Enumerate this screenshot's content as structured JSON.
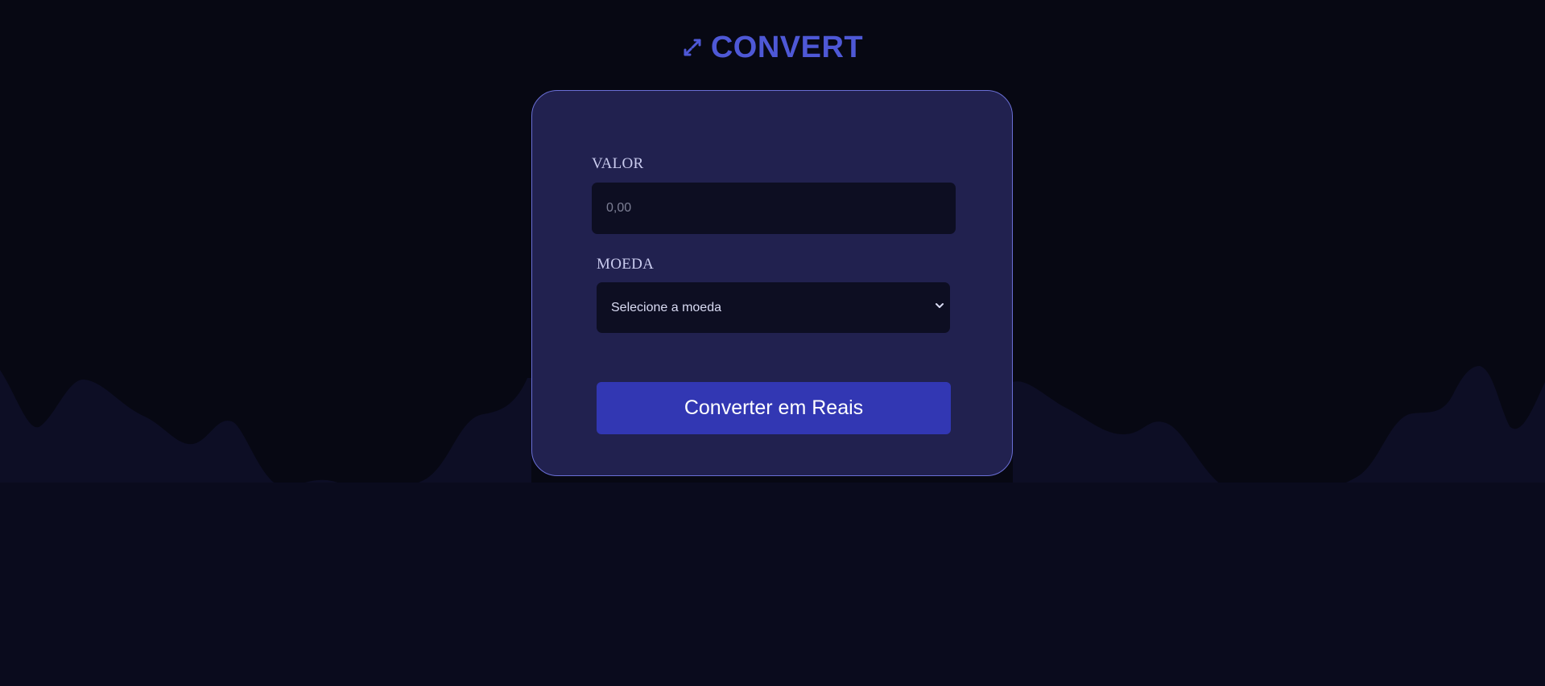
{
  "app": {
    "logo_text": "CONVERT",
    "logo_icon": "swap-arrows-icon"
  },
  "form": {
    "valor_label": "VALOR",
    "valor_placeholder": "0,00",
    "moeda_label": "MOEDA",
    "moeda_selected": "Selecione a moeda",
    "moeda_chevron_icon": "chevron-down-icon",
    "submit_label": "Converter em Reais"
  },
  "colors": {
    "background": "#070813",
    "accent": "#4e58d6",
    "card": "#21214f",
    "card_border": "#6a6fd6",
    "field": "#0d0e22",
    "button": "#3237b3",
    "wave": "#0d0e25"
  }
}
